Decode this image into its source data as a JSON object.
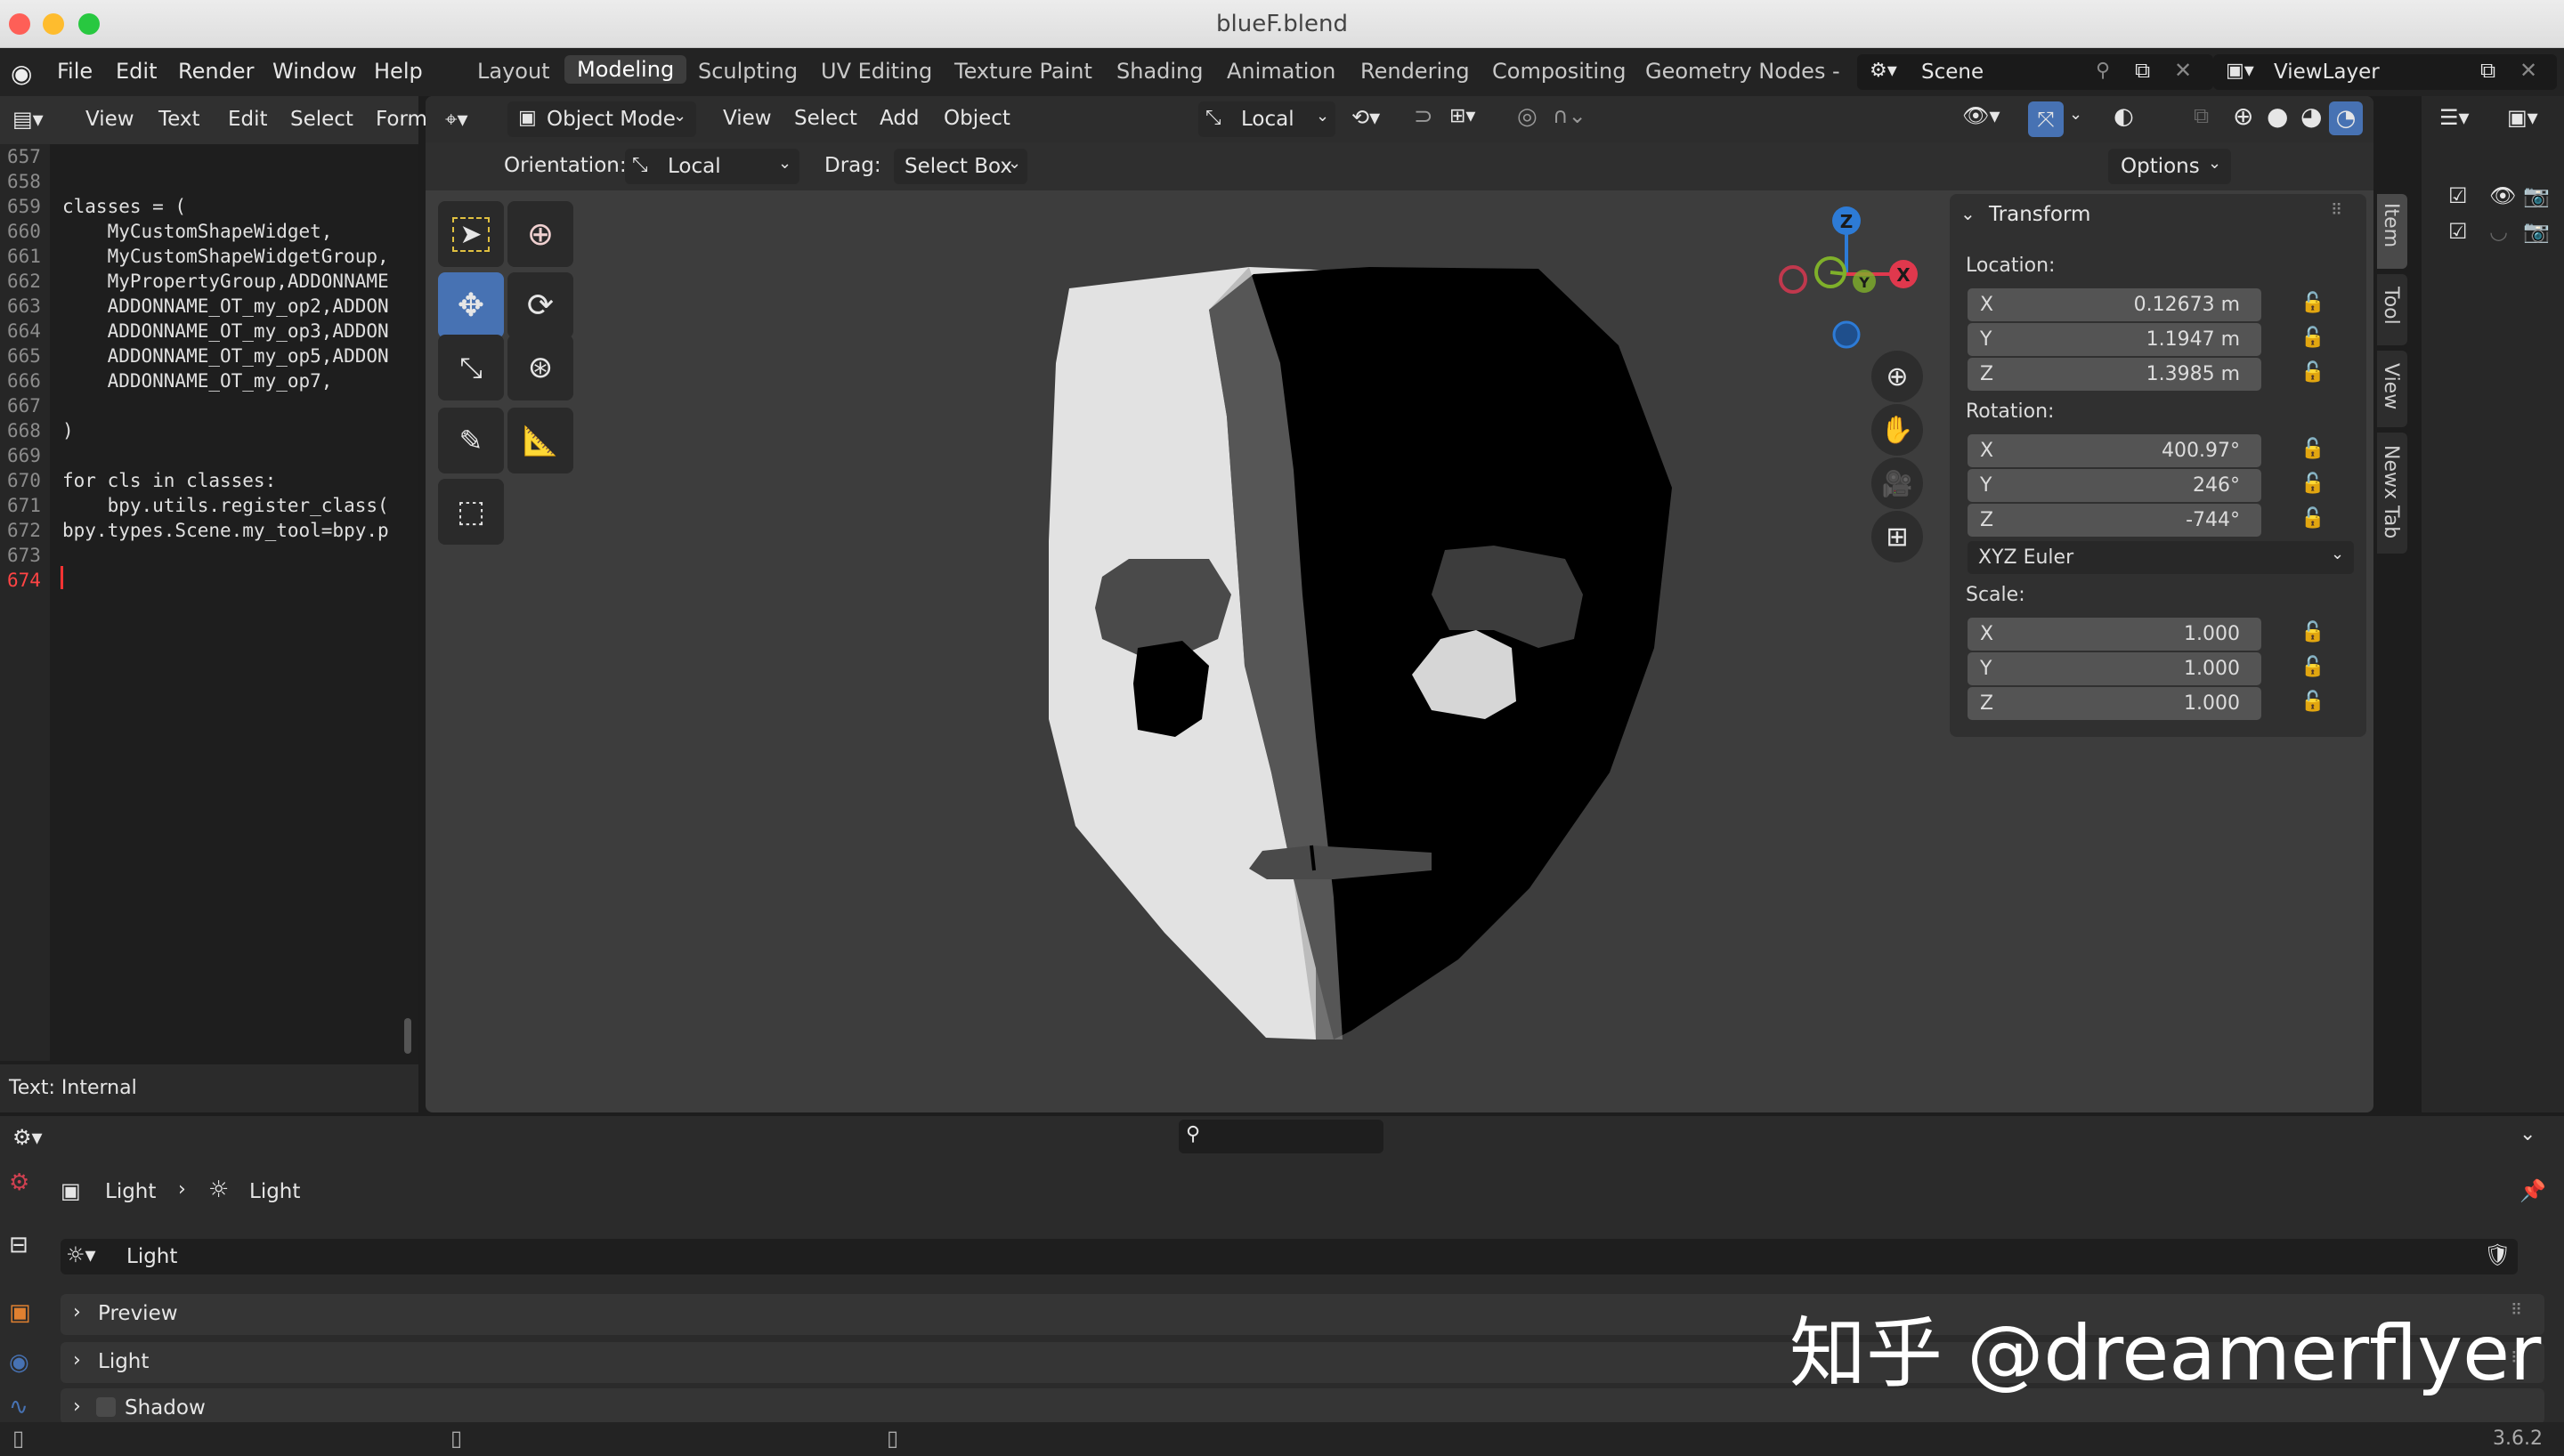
{
  "window": {
    "title": "blueF.blend"
  },
  "menubar": {
    "items": [
      "File",
      "Edit",
      "Render",
      "Window",
      "Help"
    ],
    "workspaces": [
      "Layout",
      "Modeling",
      "Sculpting",
      "UV Editing",
      "Texture Paint",
      "Shading",
      "Animation",
      "Rendering",
      "Compositing",
      "Geometry Nodes"
    ],
    "active_workspace": "Modeling",
    "scene": "Scene",
    "view_layer": "ViewLayer"
  },
  "text_editor": {
    "menus": [
      "View",
      "Text",
      "Edit",
      "Select",
      "Form"
    ],
    "lines": [
      {
        "n": "657",
        "code": ""
      },
      {
        "n": "658",
        "code": ""
      },
      {
        "n": "659",
        "code": "classes = ("
      },
      {
        "n": "660",
        "code": "    MyCustomShapeWidget,"
      },
      {
        "n": "661",
        "code": "    MyCustomShapeWidgetGroup,"
      },
      {
        "n": "662",
        "code": "    MyPropertyGroup,ADDONNAME"
      },
      {
        "n": "663",
        "code": "    ADDONNAME_OT_my_op2,ADDON"
      },
      {
        "n": "664",
        "code": "    ADDONNAME_OT_my_op3,ADDON"
      },
      {
        "n": "665",
        "code": "    ADDONNAME_OT_my_op5,ADDON"
      },
      {
        "n": "666",
        "code": "    ADDONNAME_OT_my_op7,"
      },
      {
        "n": "667",
        "code": ""
      },
      {
        "n": "668",
        "code": ")"
      },
      {
        "n": "669",
        "code": ""
      },
      {
        "n": "670",
        "code": "for cls in classes:"
      },
      {
        "n": "671",
        "code": "    bpy.utils.register_class("
      },
      {
        "n": "672",
        "code": "bpy.types.Scene.my_tool=bpy.p"
      },
      {
        "n": "673",
        "code": ""
      },
      {
        "n": "674",
        "code": ""
      }
    ],
    "footer": "Text: Internal"
  },
  "viewport": {
    "mode": "Object Mode",
    "menus": [
      "View",
      "Select",
      "Add",
      "Object"
    ],
    "transform_orientation": "Local",
    "orientation_label": "Orientation:",
    "orientation_value": "Local",
    "drag_label": "Drag:",
    "drag_value": "Select Box",
    "options": "Options",
    "gizmo": {
      "z": "Z",
      "x": "X",
      "y": "Y"
    }
  },
  "npanel": {
    "title": "Transform",
    "location_label": "Location:",
    "location": [
      {
        "axis": "X",
        "value": "0.12673 m"
      },
      {
        "axis": "Y",
        "value": "1.1947 m"
      },
      {
        "axis": "Z",
        "value": "1.3985 m"
      }
    ],
    "rotation_label": "Rotation:",
    "rotation": [
      {
        "axis": "X",
        "value": "400.97°"
      },
      {
        "axis": "Y",
        "value": "246°"
      },
      {
        "axis": "Z",
        "value": "-744°"
      }
    ],
    "rotation_mode": "XYZ Euler",
    "scale_label": "Scale:",
    "scale": [
      {
        "axis": "X",
        "value": "1.000"
      },
      {
        "axis": "Y",
        "value": "1.000"
      },
      {
        "axis": "Z",
        "value": "1.000"
      }
    ],
    "tabs": [
      "Item",
      "Tool",
      "View",
      "Newx Tab"
    ]
  },
  "properties": {
    "breadcrumb": [
      "Light",
      "Light"
    ],
    "datablock": "Light",
    "panels": [
      "Preview",
      "Light",
      "Shadow"
    ]
  },
  "watermark": "知乎 @dreamerflyer",
  "status": {
    "version": "3.6.2"
  },
  "colors": {
    "accent": "#4772b3",
    "x_axis": "#e0384d",
    "y_axis": "#7fb02a",
    "z_axis": "#2d7bd6"
  }
}
